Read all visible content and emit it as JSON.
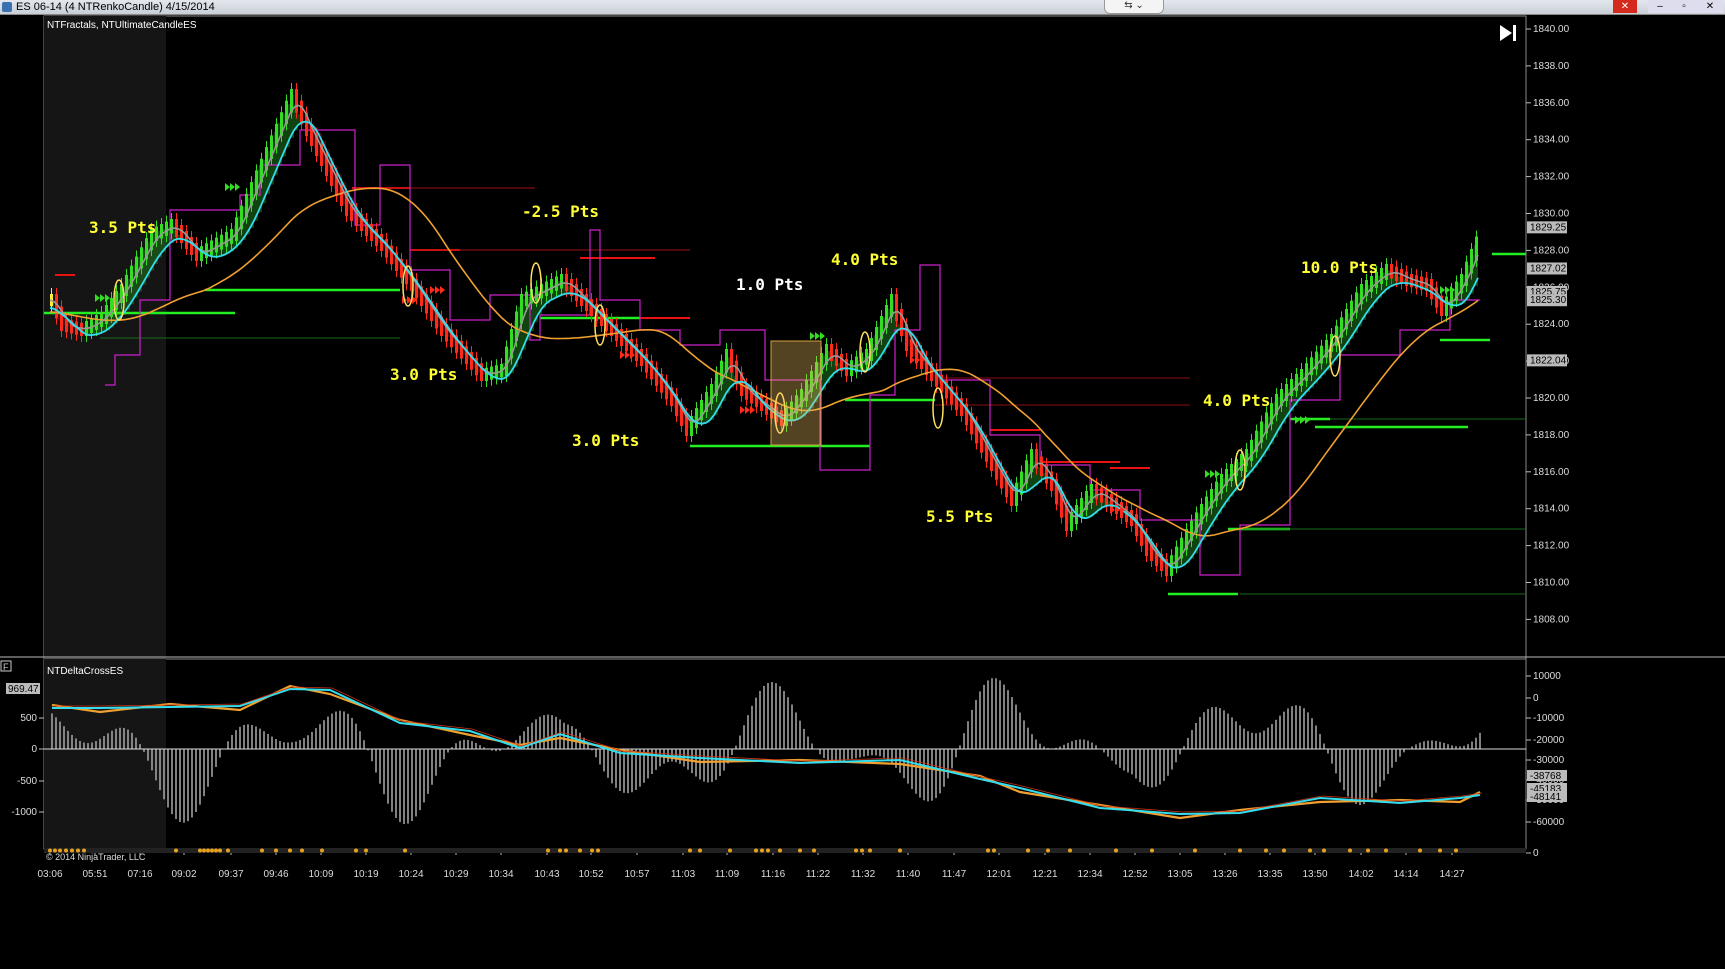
{
  "window": {
    "title": "ES 06-14 (4 NTRenkoCandle)  4/15/2014"
  },
  "panels": {
    "price_indicator_label": "NTFractals, NTUltimateCandleES",
    "delta_indicator_label": "NTDeltaCrossES",
    "delta_collapse_label": "F",
    "copyright": "© 2014 NinjaTrader, LLC"
  },
  "price_axis": {
    "ticks": [
      "1840.00",
      "1838.00",
      "1836.00",
      "1834.00",
      "1832.00",
      "1830.00",
      "1828.00",
      "1826.00",
      "1824.00",
      "1822.00",
      "1820.00",
      "1818.00",
      "1816.00",
      "1814.00",
      "1812.00",
      "1810.00",
      "1808.00"
    ],
    "markers": [
      "1829.25",
      "1827.02",
      "1825.75",
      "1825.30",
      "1822.04"
    ]
  },
  "delta_axis_right": {
    "ticks": [
      "10000",
      "0",
      "-10000",
      "-20000",
      "-30000",
      "-40000",
      "-50000",
      "-60000",
      "0"
    ],
    "markers": [
      "-38768",
      "-45183",
      "-48141"
    ]
  },
  "delta_axis_left": {
    "ticks": [
      "500",
      "0",
      "-500",
      "-1000"
    ],
    "marker": "969.47"
  },
  "time_axis": [
    "03:06",
    "05:51",
    "07:16",
    "09:02",
    "09:37",
    "09:46",
    "10:09",
    "10:19",
    "10:24",
    "10:29",
    "10:34",
    "10:43",
    "10:52",
    "10:57",
    "11:03",
    "11:09",
    "11:16",
    "11:22",
    "11:32",
    "11:40",
    "11:47",
    "12:01",
    "12:21",
    "12:34",
    "12:52",
    "13:05",
    "13:26",
    "13:35",
    "13:50",
    "14:02",
    "14:14",
    "14:27"
  ],
  "annotations": [
    {
      "text": "3.5 Pts",
      "color": "#ffff33"
    },
    {
      "text": "-2.5 Pts",
      "color": "#ffff33"
    },
    {
      "text": "1.0 Pts",
      "color": "#ffffff"
    },
    {
      "text": "4.0 Pts",
      "color": "#ffff33"
    },
    {
      "text": "10.0 Pts",
      "color": "#ffff33"
    },
    {
      "text": "3.0 Pts",
      "color": "#ffff33"
    },
    {
      "text": "3.0 Pts",
      "color": "#ffff33"
    },
    {
      "text": "4.0 Pts",
      "color": "#ffff33"
    },
    {
      "text": "5.5 Pts",
      "color": "#ffff33"
    }
  ],
  "colors": {
    "up_candle": "#33dd22",
    "down_candle": "#ff2a1a",
    "neutral_candle": "#ffee33",
    "fast_ma": "#33ddee",
    "mid_ma": "#999999",
    "slow_ma": "#f0a030",
    "fractal": "#cc22cc",
    "support": "#22ee22",
    "resistance": "#ee1111"
  }
}
